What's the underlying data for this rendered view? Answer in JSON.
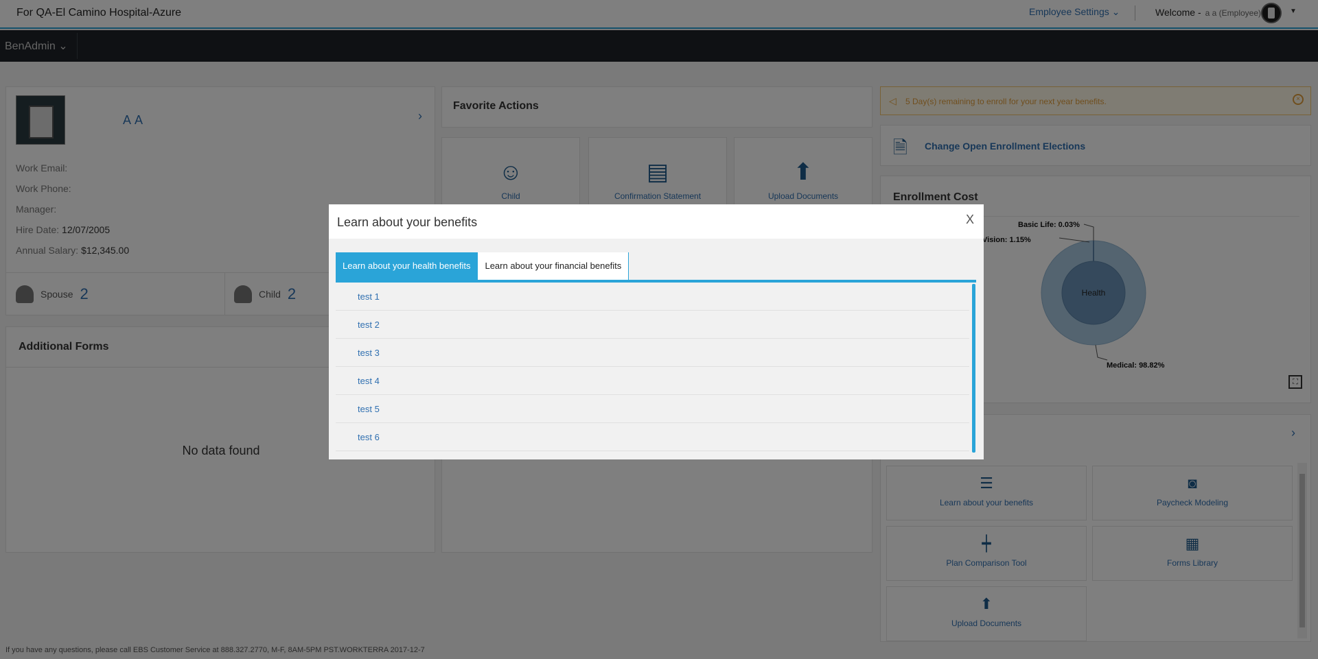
{
  "header": {
    "client": "For QA-El Camino Hospital-Azure",
    "employee_settings": "Employee Settings",
    "welcome_label": "Welcome -",
    "welcome_user": "a a (Employee)"
  },
  "nav": {
    "app_menu": "BenAdmin"
  },
  "profile": {
    "name": "A A",
    "work_email_label": "Work Email:",
    "work_phone_label": "Work Phone:",
    "manager_label": "Manager:",
    "hire_date_label": "Hire Date:",
    "hire_date": "12/07/2005",
    "salary_label": "Annual Salary:",
    "salary": "$12,345.00",
    "spouse_label": "Spouse",
    "spouse_count": "2",
    "child_label": "Child",
    "child_count": "2"
  },
  "additional_forms": {
    "title": "Additional Forms",
    "empty": "No data found"
  },
  "favorite_actions": {
    "title": "Favorite Actions",
    "items": [
      {
        "label": "Child",
        "icon": "child-icon"
      },
      {
        "label": "Confirmation Statement",
        "icon": "statement-icon"
      },
      {
        "label": "Upload Documents",
        "icon": "upload-icon"
      }
    ]
  },
  "alert": {
    "text": "5 Day(s) remaining to enroll for your next year benefits."
  },
  "change_enrollment": {
    "label": "Change Open Enrollment Elections"
  },
  "enrollment_cost": {
    "title": "Enrollment Cost",
    "center_label": "Health"
  },
  "chart_data": {
    "type": "pie",
    "title": "Enrollment Cost",
    "slices": [
      {
        "label": "Medical",
        "value": 98.82
      },
      {
        "label": "Vision",
        "value": 1.15
      },
      {
        "label": "Basic Life",
        "value": 0.03
      }
    ],
    "slice_labels": [
      "Medical: 98.82%",
      "Vision: 1.15%",
      "Basic Life: 0.03%"
    ],
    "inner_label": "Health",
    "colors": {
      "outer": "#a8c8e0",
      "inner": "#6b93b8"
    }
  },
  "tools": {
    "items": [
      {
        "label": "Learn about your benefits",
        "icon": "document-icon"
      },
      {
        "label": "Paycheck Modeling",
        "icon": "money-icon"
      },
      {
        "label": "Plan Comparison Tool",
        "icon": "compare-icon"
      },
      {
        "label": "Forms Library",
        "icon": "forms-icon"
      },
      {
        "label": "Upload Documents",
        "icon": "upload-icon"
      }
    ]
  },
  "footer": {
    "text": "If you have any questions, please call EBS Customer Service at 888.327.2770, M-F, 8AM-5PM PST.WORKTERRA 2017-12-7"
  },
  "modal": {
    "title": "Learn about your benefits",
    "close": "X",
    "tabs": [
      {
        "label": "Learn about your health benefits",
        "active": true
      },
      {
        "label": "Learn about your financial benefits",
        "active": false
      }
    ],
    "items": [
      "test 1",
      "test 2",
      "test 3",
      "test 4",
      "test 5",
      "test 6"
    ]
  },
  "colors": {
    "accent": "#2aa4d8",
    "link": "#2f6fb0",
    "nav": "#1e2328",
    "warning": "#e09d3a"
  }
}
